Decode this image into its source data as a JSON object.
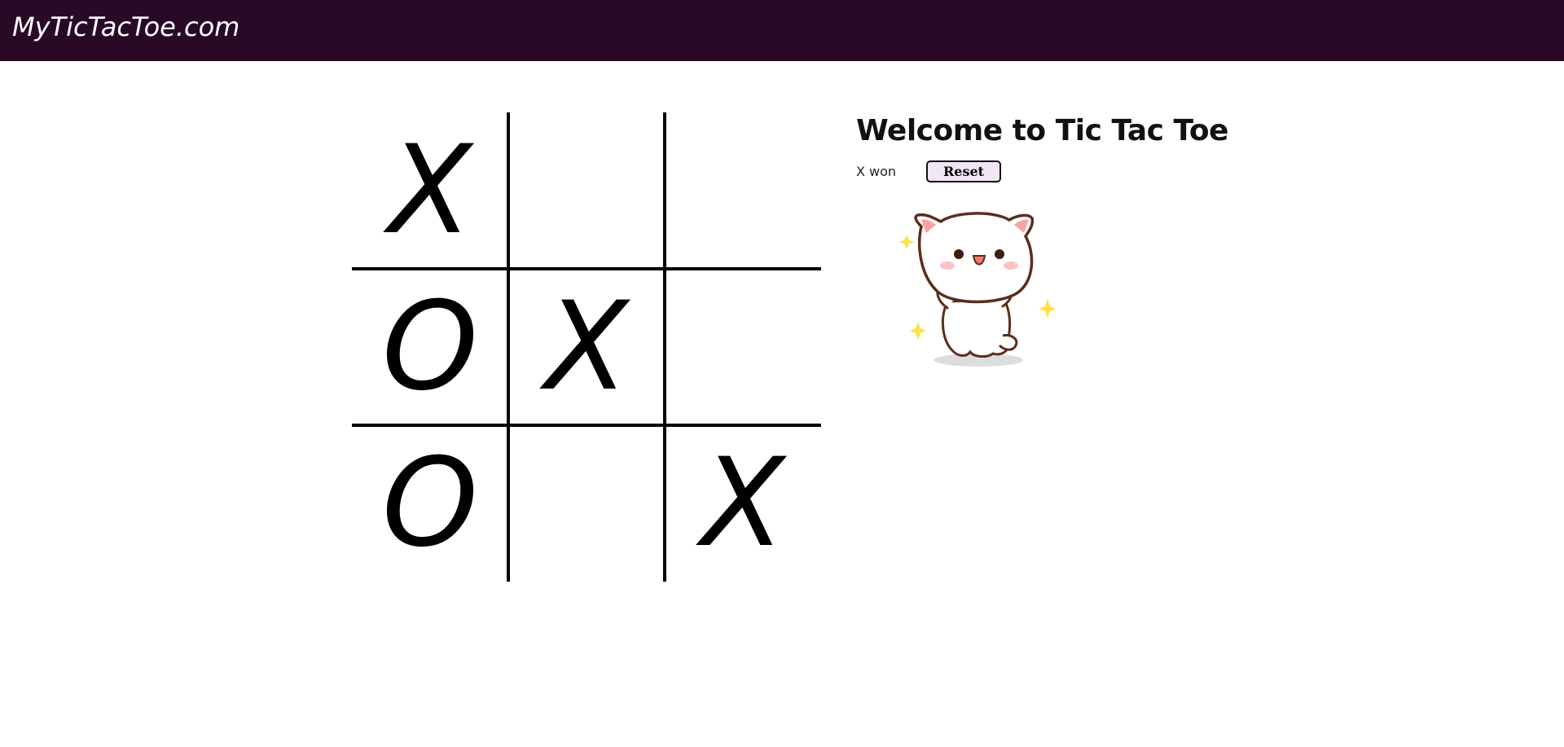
{
  "header": {
    "brand": "MyTicTacToe.com"
  },
  "board": {
    "cells": [
      "X",
      "",
      "",
      "O",
      "X",
      "",
      "O",
      "",
      "X"
    ]
  },
  "panel": {
    "title": "Welcome to Tic Tac Toe",
    "status": "X won",
    "reset_label": "Reset"
  },
  "colors": {
    "topbar": "#280a26",
    "reset_bg": "#f0e6f5",
    "sparkle": "#ffe14d"
  }
}
